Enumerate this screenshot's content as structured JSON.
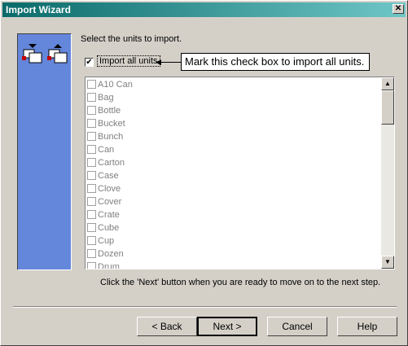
{
  "window": {
    "title": "Import Wizard",
    "close_glyph": "✕"
  },
  "instructions": "Select the units to import.",
  "import_all": {
    "label": "Import all units",
    "checked": true,
    "check_glyph": "✔"
  },
  "callout": {
    "text": "Mark this check box to import all units.",
    "arrow_glyph": "◀"
  },
  "units": [
    "A10 Can",
    "Bag",
    "Bottle",
    "Bucket",
    "Bunch",
    "Can",
    "Carton",
    "Case",
    "Clove",
    "Cover",
    "Crate",
    "Cube",
    "Cup",
    "Dozen",
    "Drum"
  ],
  "scrollbar": {
    "up_glyph": "▲",
    "down_glyph": "▼"
  },
  "bottom_hint": "Click the 'Next' button when you are ready to move on to the next step.",
  "buttons": {
    "back": "< Back",
    "next": "Next >",
    "cancel": "Cancel",
    "help": "Help"
  },
  "colors": {
    "title_start": "#0a6a6a",
    "title_end": "#6fc6c6",
    "side_panel": "#6487dc",
    "face": "#d4d0c8"
  }
}
